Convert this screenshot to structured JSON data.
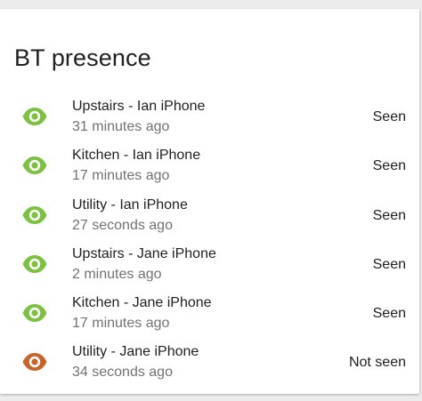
{
  "card": {
    "title": "BT presence"
  },
  "colors": {
    "seen": "#7cc142",
    "not_seen": "#c8642a"
  },
  "entities": [
    {
      "name": "Upstairs - Ian iPhone",
      "last_changed": "31 minutes ago",
      "state": "Seen",
      "icon": "eye-icon"
    },
    {
      "name": "Kitchen - Ian iPhone",
      "last_changed": "17 minutes ago",
      "state": "Seen",
      "icon": "eye-icon"
    },
    {
      "name": "Utility - Ian iPhone",
      "last_changed": "27 seconds ago",
      "state": "Seen",
      "icon": "eye-icon"
    },
    {
      "name": "Upstairs - Jane iPhone",
      "last_changed": "2 minutes ago",
      "state": "Seen",
      "icon": "eye-icon"
    },
    {
      "name": "Kitchen - Jane iPhone",
      "last_changed": "17 minutes ago",
      "state": "Seen",
      "icon": "eye-icon"
    },
    {
      "name": "Utility - Jane iPhone",
      "last_changed": "34 seconds ago",
      "state": "Not seen",
      "icon": "eye-icon"
    }
  ]
}
